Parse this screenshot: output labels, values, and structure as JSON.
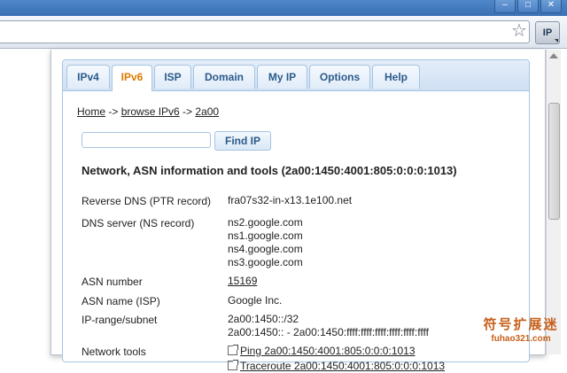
{
  "browser": {
    "window_buttons": [
      "–",
      "□",
      "✕"
    ],
    "ext_button_label": "IP"
  },
  "tabs": [
    {
      "label": "IPv4",
      "active": false
    },
    {
      "label": "IPv6",
      "active": true
    },
    {
      "label": "ISP",
      "active": false
    },
    {
      "label": "Domain",
      "active": false
    },
    {
      "label": "My IP",
      "active": false
    },
    {
      "label": "Options",
      "active": false
    },
    {
      "label": "Help",
      "active": false
    }
  ],
  "breadcrumb": {
    "home": "Home",
    "sep1": " -> ",
    "browse": "browse IPv6",
    "sep2": " -> ",
    "current": "2a00"
  },
  "search": {
    "value": "",
    "button_label": "Find IP"
  },
  "heading": "Network, ASN information and tools (2a00:1450:4001:805:0:0:0:1013)",
  "rows": {
    "reverse_dns": {
      "label": "Reverse DNS (PTR record)",
      "value": "fra07s32-in-x13.1e100.net"
    },
    "dns_server": {
      "label": "DNS server (NS record)",
      "values": [
        "ns2.google.com",
        "ns1.google.com",
        "ns4.google.com",
        "ns3.google.com"
      ]
    },
    "asn_number": {
      "label": "ASN number",
      "value": "15169"
    },
    "asn_name": {
      "label": "ASN name (ISP)",
      "value": "Google Inc."
    },
    "ip_range": {
      "label": "IP-range/subnet",
      "values": [
        "2a00:1450::/32",
        "2a00:1450:: - 2a00:1450:ffff:ffff:ffff:ffff:ffff:ffff"
      ]
    },
    "network_tools": {
      "label": "Network tools",
      "links": [
        "Ping 2a00:1450:4001:805:0:0:0:1013",
        "Traceroute 2a00:1450:4001:805:0:0:0:1013"
      ]
    }
  },
  "watermark": {
    "cn": "符号扩展迷",
    "en": "fuhao321.com"
  },
  "colors": {
    "tab_active_text": "#e07b00",
    "tab_text": "#2b5a8a",
    "tab_border": "#a6c4e2"
  }
}
